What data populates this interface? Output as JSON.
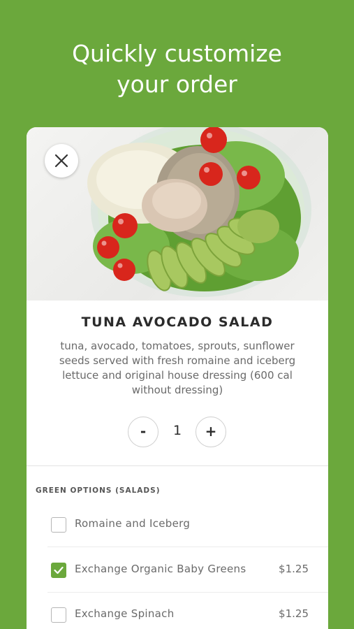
{
  "headline": {
    "line1": "Quickly customize",
    "line2": "your order"
  },
  "item": {
    "title": "TUNA AVOCADO SALAD",
    "description": "tuna, avocado, tomatoes, sprouts, sunflower seeds served with fresh romaine and iceberg lettuce and original house dressing (600 cal without dressing)",
    "close_icon": "close-icon"
  },
  "quantity": {
    "minus": "-",
    "value": "1",
    "plus": "+"
  },
  "options": {
    "section_label": "GREEN OPTIONS (SALADS)",
    "items": [
      {
        "label": "Romaine and Iceberg",
        "price": "",
        "checked": false
      },
      {
        "label": "Exchange Organic Baby Greens",
        "price": "$1.25",
        "checked": true
      },
      {
        "label": "Exchange Spinach",
        "price": "$1.25",
        "checked": false
      }
    ]
  },
  "colors": {
    "brand_green": "#6ba83c",
    "text_dark": "#2b2b2b",
    "text_muted": "#6a6a6a"
  }
}
